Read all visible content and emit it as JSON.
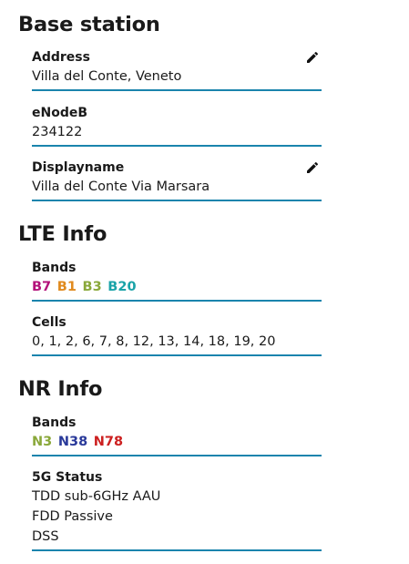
{
  "base_station": {
    "title": "Base station",
    "address": {
      "label": "Address",
      "value": "Villa del Conte, Veneto",
      "icon": "pencil-icon"
    },
    "enodeb": {
      "label": "eNodeB",
      "value": "234122"
    },
    "displayname": {
      "label": "Displayname",
      "value": "Villa del Conte Via Marsara",
      "icon": "pencil-icon"
    }
  },
  "lte_info": {
    "title": "LTE Info",
    "bands": {
      "label": "Bands",
      "items": [
        {
          "name": "B7",
          "color": "#b3117a"
        },
        {
          "name": "B1",
          "color": "#e08a1e"
        },
        {
          "name": "B3",
          "color": "#8aa83a"
        },
        {
          "name": "B20",
          "color": "#1aa3a8"
        }
      ]
    },
    "cells": {
      "label": "Cells",
      "value": "0, 1, 2, 6, 7, 8, 12, 13, 14, 18, 19, 20"
    }
  },
  "nr_info": {
    "title": "NR Info",
    "bands": {
      "label": "Bands",
      "items": [
        {
          "name": "N3",
          "color": "#8aa83a"
        },
        {
          "name": "N38",
          "color": "#2a3a9a"
        },
        {
          "name": "N78",
          "color": "#cc2020"
        }
      ]
    },
    "status": {
      "label": "5G Status",
      "lines": [
        "TDD sub-6GHz AAU",
        "FDD Passive",
        "DSS"
      ]
    }
  },
  "colors": {
    "underline": "#1a84ad",
    "text": "#1a1a1a"
  }
}
